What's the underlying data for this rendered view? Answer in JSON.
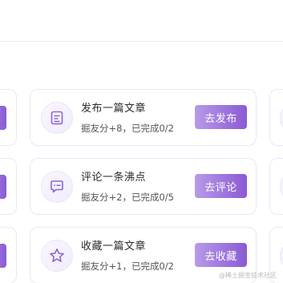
{
  "tasks": [
    {
      "title": "发布一篇文章",
      "reward": "掘友分+8，已完成0/2",
      "button": "去发布",
      "icon": "article-icon"
    },
    {
      "title": "评论一条沸点",
      "reward": "掘友分+2，已完成0/5",
      "button": "去评论",
      "icon": "comment-icon"
    },
    {
      "title": "收藏一篇文章",
      "reward": "掘友分+1，已完成0/2",
      "button": "去收藏",
      "icon": "star-icon"
    }
  ],
  "watermark": "@稀土掘金技术社区",
  "colors": {
    "accent_start": "#b79ae8",
    "accent_end": "#8a5ad4",
    "icon_stroke": "#8c66d6",
    "card_border": "#ebe6f5"
  }
}
